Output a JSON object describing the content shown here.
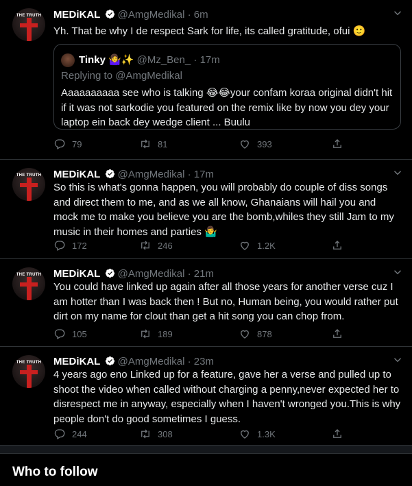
{
  "tweets": [
    {
      "name": "MEDiKAL",
      "handle": "@AmgMedikal",
      "dot": "·",
      "time": "6m",
      "text": "Yh. That be why I de respect Sark for life, its called gratitude, ofui 🙂",
      "quote": {
        "name": "Tinky 🤷‍♀️✨",
        "handle": "@Mz_Ben_",
        "dot": "·",
        "time": "17m",
        "reply": "Replying to @AmgMedikal",
        "text": "Aaaaaaaaaa see who is talking 😂😂your confam koraa original didn't hit if it was not sarkodie you featured on the remix like by now you dey your laptop ein back dey wedge client ... Buulu"
      },
      "replies": "79",
      "retweets": "81",
      "likes": "393"
    },
    {
      "name": "MEDiKAL",
      "handle": "@AmgMedikal",
      "dot": "·",
      "time": "17m",
      "text": "So this is what's gonna happen, you will probably do couple of diss songs and direct them to me, and as we all know, Ghanaians will hail you and mock me to make you believe you are the bomb,whiles they still Jam to my music in their homes and parties 🤷‍♂️",
      "replies": "172",
      "retweets": "246",
      "likes": "1.2K"
    },
    {
      "name": "MEDiKAL",
      "handle": "@AmgMedikal",
      "dot": "·",
      "time": "21m",
      "text": "You could have linked up again after all those years for another verse cuz I am hotter than I was back then ! But no, Human being, you would rather put dirt on my name for clout than get a hit song you can chop from.",
      "replies": "105",
      "retweets": "189",
      "likes": "878"
    },
    {
      "name": "MEDiKAL",
      "handle": "@AmgMedikal",
      "dot": "·",
      "time": "23m",
      "text": "4 years ago eno Linked up for a feature, gave her a verse and pulled up to shoot the video when called without charging a penny,never expected her to disrespect me in anyway, especially when I haven't wronged you.This is why people don't do good sometimes I guess.",
      "replies": "244",
      "retweets": "308",
      "likes": "1.3K"
    }
  ],
  "avatar_text": "THE TRUTH",
  "who_to_follow": "Who to follow",
  "colors": {
    "background": "#000000",
    "muted": "#71767b",
    "verified": "#ffffff",
    "divider": "#2f3336"
  },
  "icons": [
    "reply-icon",
    "retweet-icon",
    "like-icon",
    "share-icon",
    "chevron-down-icon",
    "verified-icon"
  ]
}
